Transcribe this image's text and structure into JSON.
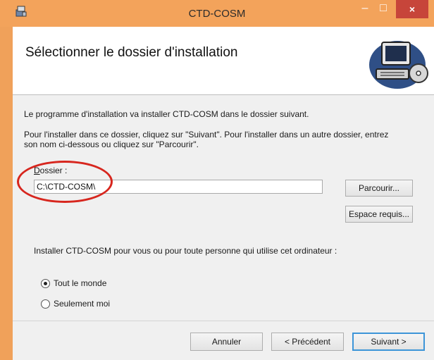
{
  "window": {
    "title": "CTD-COSM",
    "minimize_glyph": "–",
    "maximize_glyph": "□",
    "close_glyph": "×",
    "accent_color": "#f3a35b",
    "close_color": "#c7453a"
  },
  "header": {
    "title": "Sélectionner le dossier d'installation",
    "art_icon": "computer-disc-icon"
  },
  "content": {
    "intro": "Le programme d'installation va installer CTD-COSM dans le dossier suivant.",
    "instructions_line1": "Pour l'installer dans ce dossier, cliquez sur \"Suivant\". Pour l'installer dans un autre dossier, entrez",
    "instructions_line2": "son nom ci-dessous ou cliquez sur \"Parcourir\".",
    "folder_label_accel": "D",
    "folder_label_rest": "ossier :",
    "folder_value": "C:\\CTD-COSM\\",
    "browse_button": "Parcourir...",
    "disk_space_button": "Espace requis...",
    "install_for_label": "Installer CTD-COSM pour vous ou pour toute personne qui utilise cet ordinateur :",
    "radio_options": [
      {
        "label": "Tout le monde",
        "selected": true
      },
      {
        "label": "Seulement moi",
        "selected": false
      }
    ]
  },
  "footer": {
    "cancel_button": "Annuler",
    "back_button": "< Précédent",
    "next_button": "Suivant >"
  }
}
